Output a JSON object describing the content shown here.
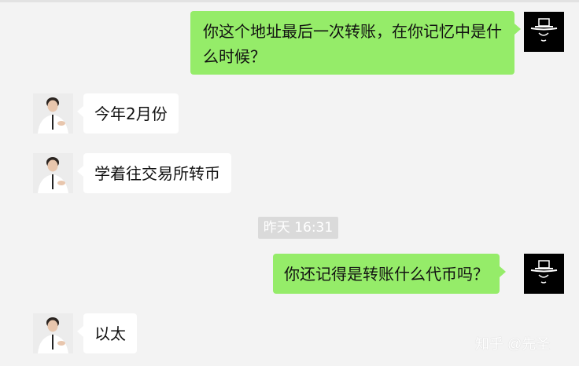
{
  "messages": [
    {
      "sender": "self",
      "text": "你这个地址最后一次转账，在你记忆中是什么时候？"
    },
    {
      "sender": "other",
      "text": "今年2月份"
    },
    {
      "sender": "other",
      "text": "学着往交易所转币"
    },
    {
      "sender": "self",
      "text": "你还记得是转账什么代币吗？"
    },
    {
      "sender": "other",
      "text": "以太"
    }
  ],
  "timestamp": "昨天 16:31",
  "watermark": "知乎 @先圣",
  "colors": {
    "background": "#f3f3f3",
    "self_bubble": "#95ec69",
    "other_bubble": "#ffffff",
    "timestamp_bg": "#dadada"
  },
  "icons": {
    "self_avatar": "black-hat-avatar-icon",
    "other_avatar": "man-in-white-shirt-avatar-icon"
  }
}
